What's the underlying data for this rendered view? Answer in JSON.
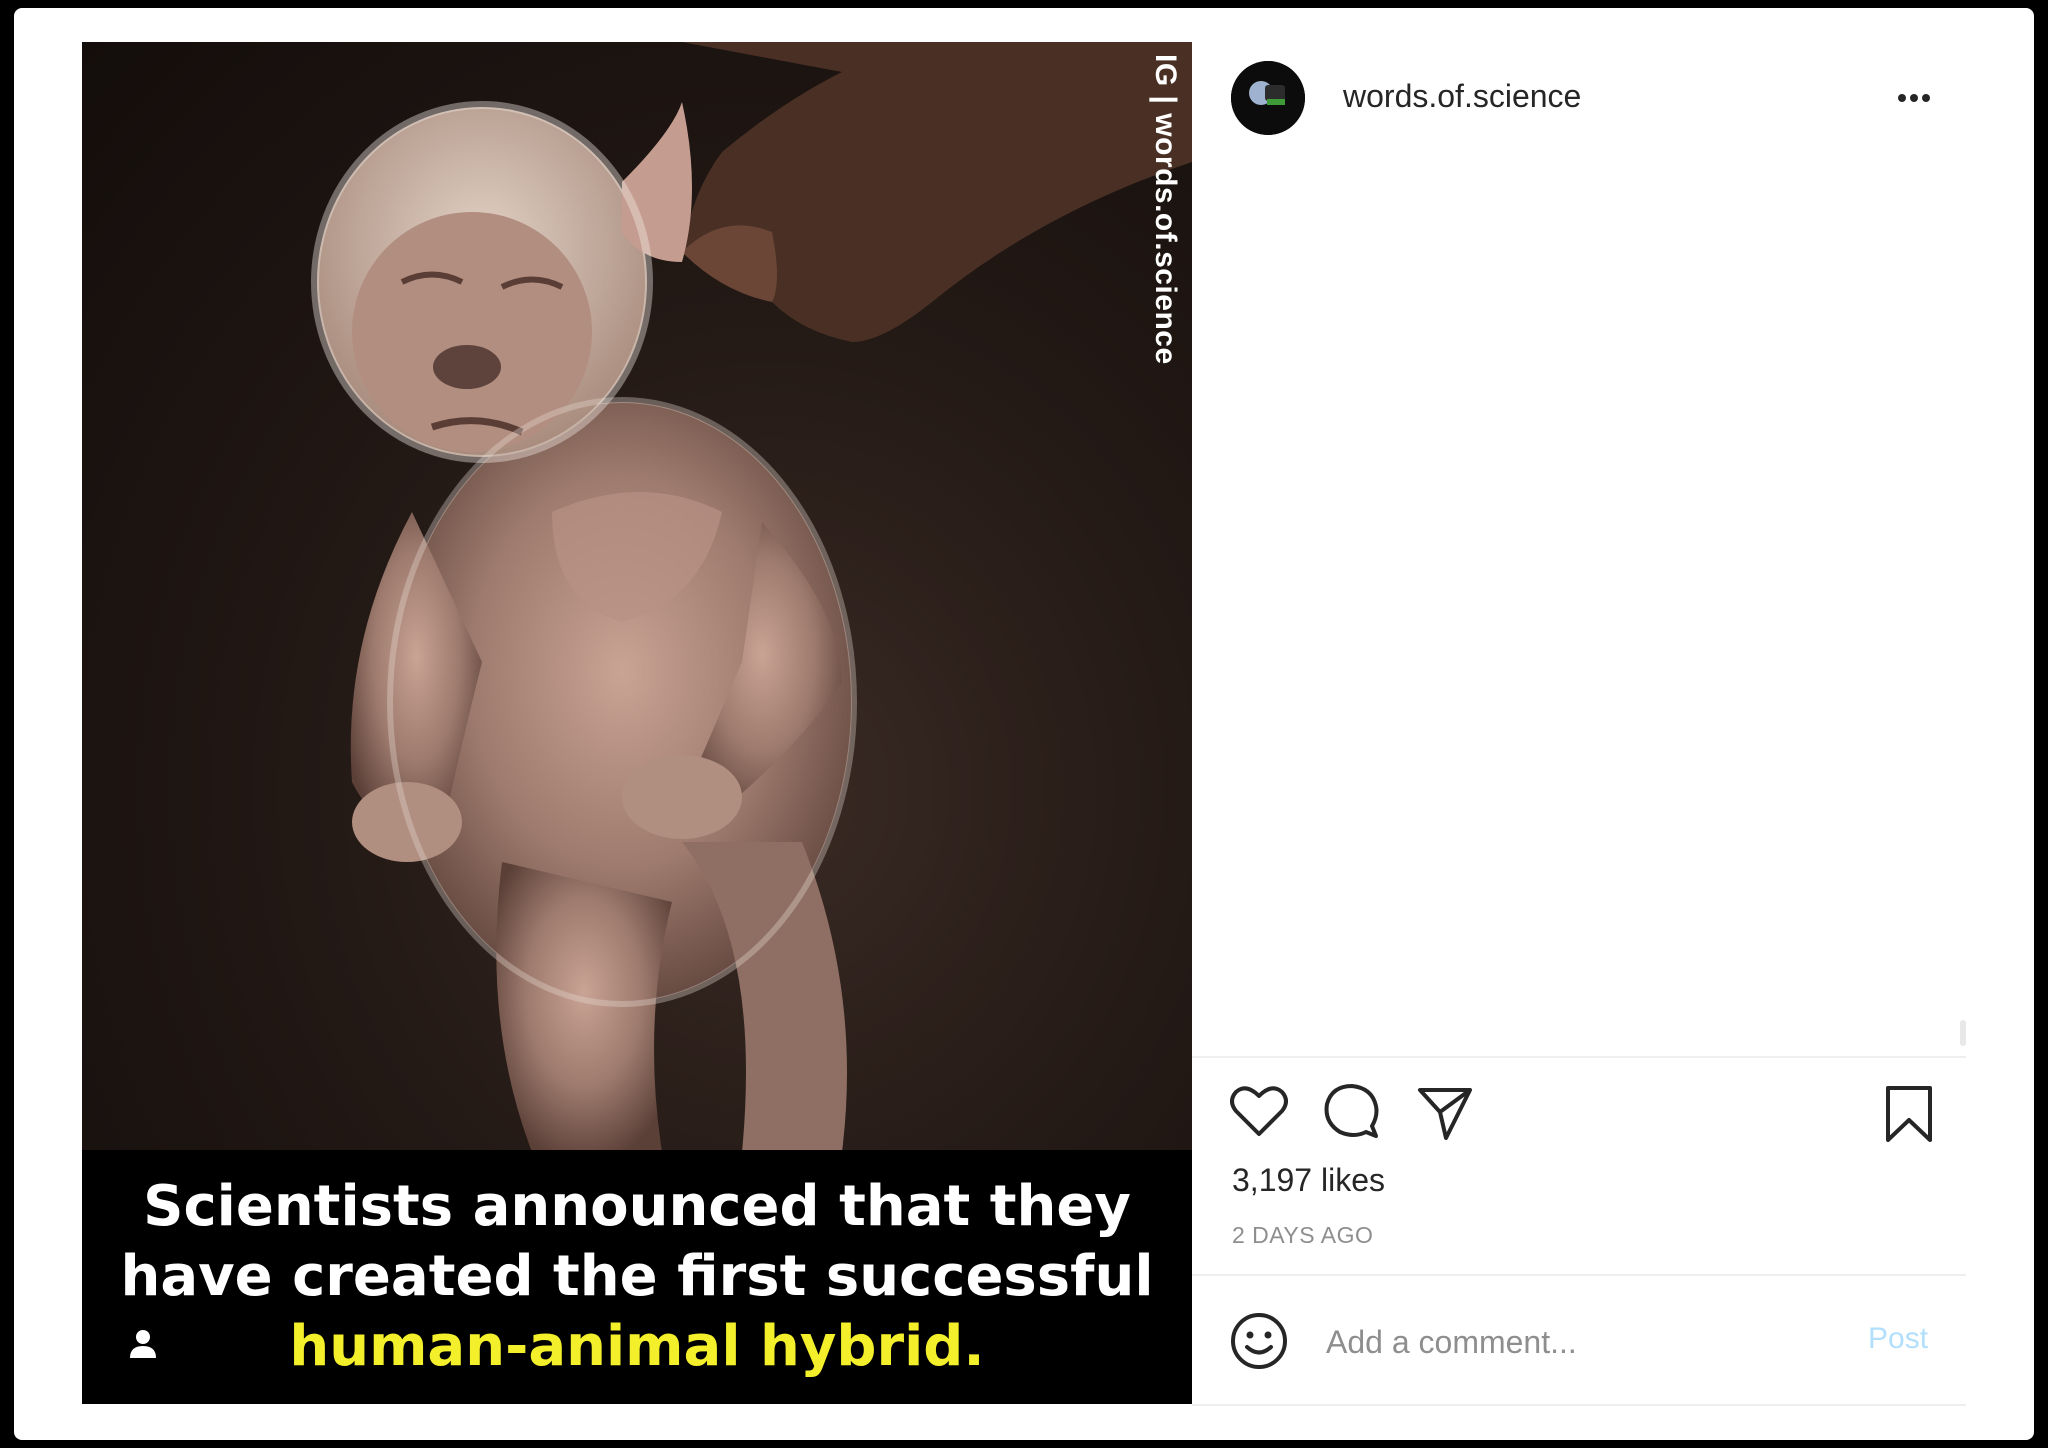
{
  "post": {
    "watermark": "IG | words.of.science",
    "caption_lines": [
      "Scientists announced that they",
      "have created the first successful",
      "human-animal hybrid."
    ],
    "highlight_color": "#f3ef2b"
  },
  "header": {
    "username": "words.of.science",
    "more_icon": "more-horizontal-icon"
  },
  "actions": {
    "icons": [
      "heart-icon",
      "comment-icon",
      "share-icon",
      "bookmark-icon"
    ]
  },
  "stats": {
    "likes": "3,197 likes",
    "time_ago": "2 DAYS AGO"
  },
  "comment_box": {
    "placeholder": "Add a comment...",
    "post_label": "Post",
    "emoji_icon": "smile-icon"
  },
  "colors": {
    "post_button": "#b2dffc",
    "text": "#262626",
    "muted": "#8e8e8e"
  }
}
